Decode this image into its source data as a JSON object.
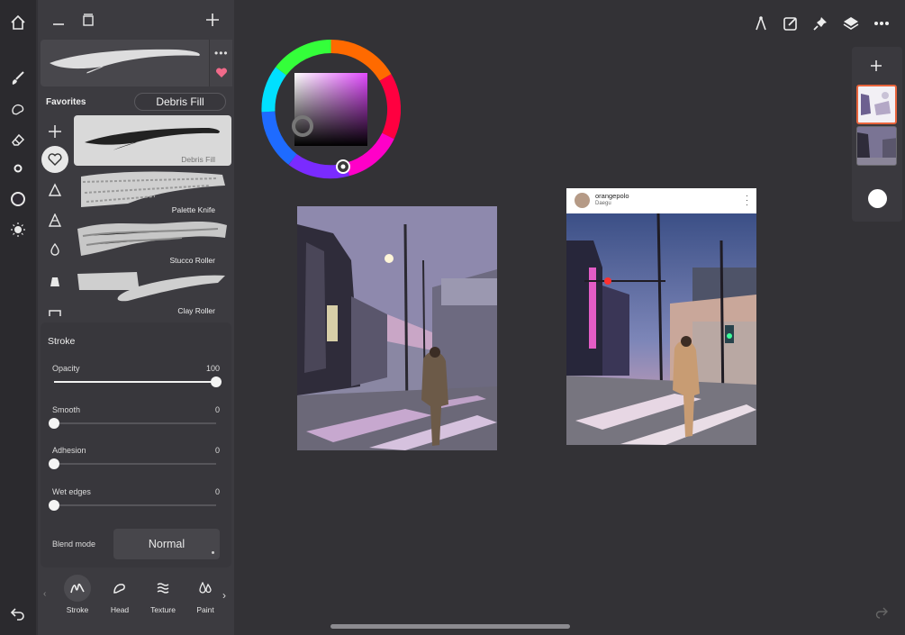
{
  "app": {
    "rail_icons": [
      "home-icon",
      "brush-icon",
      "smudge-icon",
      "eraser-icon",
      "brush-size-icon",
      "color-swatch-icon",
      "opacity-icon"
    ],
    "undo_icon": "undo-icon",
    "redo_icon": "redo-icon"
  },
  "brush_panel": {
    "favorites_label": "Favorites",
    "current_brush": "Debris Fill",
    "categories": [
      "add-icon",
      "heart-icon",
      "triangle-icon",
      "cone-icon",
      "drop-icon",
      "block-icon",
      "stroke-icon"
    ],
    "brushes": [
      {
        "name": "Debris Fill"
      },
      {
        "name": "Palette Knife"
      },
      {
        "name": "Stucco Roller"
      },
      {
        "name": "Clay Roller"
      }
    ]
  },
  "stroke": {
    "title": "Stroke",
    "params": [
      {
        "label": "Opacity",
        "value": "100",
        "fraction": 1.0
      },
      {
        "label": "Smooth",
        "value": "0",
        "fraction": 0.0
      },
      {
        "label": "Adhesion",
        "value": "0",
        "fraction": 0.0
      },
      {
        "label": "Wet edges",
        "value": "0",
        "fraction": 0.0
      }
    ],
    "blend_label": "Blend mode",
    "blend_value": "Normal"
  },
  "tabs": [
    {
      "label": "Stroke",
      "active": true
    },
    {
      "label": "Head",
      "active": false
    },
    {
      "label": "Texture",
      "active": false
    },
    {
      "label": "Paint",
      "active": false
    }
  ],
  "toolbar": {
    "icons": [
      "ruler-icon",
      "edit-icon",
      "pin-icon",
      "layers-icon",
      "more-icon"
    ]
  },
  "reference": {
    "username": "orangepolo",
    "location": "Daegu"
  },
  "colors": {
    "accent_selected_layer": "#e8643c",
    "current_color": "#2e2a33"
  }
}
